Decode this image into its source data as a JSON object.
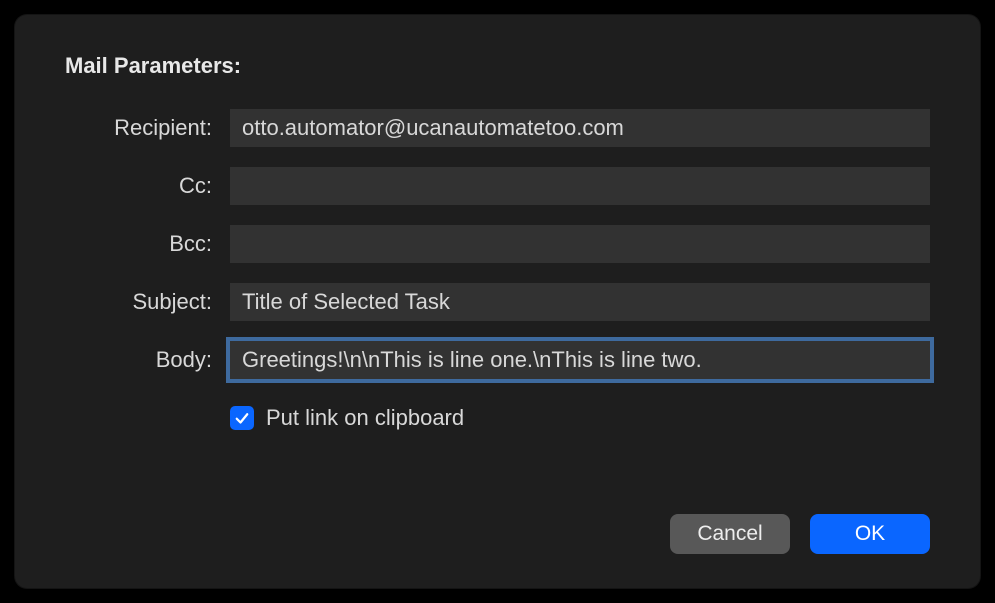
{
  "title": "Mail Parameters:",
  "fields": {
    "recipient": {
      "label": "Recipient:",
      "value": "otto.automator@ucanautomatetoo.com"
    },
    "cc": {
      "label": "Cc:",
      "value": ""
    },
    "bcc": {
      "label": "Bcc:",
      "value": ""
    },
    "subject": {
      "label": "Subject:",
      "value": "Title of Selected Task"
    },
    "body": {
      "label": "Body:",
      "value": "Greetings!\\n\\nThis is line one.\\nThis is line two."
    }
  },
  "checkbox": {
    "label": "Put link on clipboard",
    "checked": true
  },
  "buttons": {
    "cancel": "Cancel",
    "ok": "OK"
  }
}
